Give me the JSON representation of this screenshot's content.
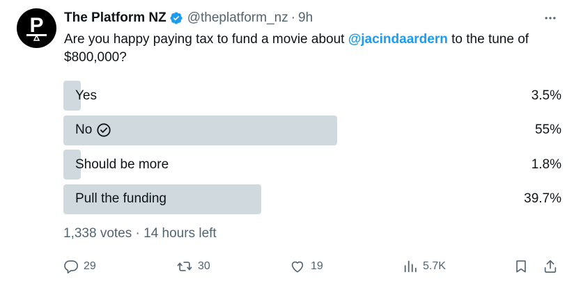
{
  "author": {
    "display_name": "The Platform NZ",
    "handle": "@theplatform_nz",
    "separator": "·",
    "time": "9h",
    "avatar_letter": "P"
  },
  "tweet": {
    "text_before": "Are you happy paying tax to fund a movie about ",
    "mention": "@jacindaardern",
    "text_after": " to the tune of $800,000?"
  },
  "poll": {
    "options": [
      {
        "label": "Yes",
        "percent_label": "3.5%",
        "percent": 3.5,
        "winner": false
      },
      {
        "label": "No",
        "percent_label": "55%",
        "percent": 55,
        "winner": true
      },
      {
        "label": "Should be more",
        "percent_label": "1.8%",
        "percent": 1.8,
        "winner": false
      },
      {
        "label": "Pull the funding",
        "percent_label": "39.7%",
        "percent": 39.7,
        "winner": false
      }
    ],
    "meta": "1,338 votes · 14 hours left"
  },
  "actions": {
    "replies": "29",
    "reposts": "30",
    "likes": "19",
    "views": "5.7K"
  },
  "colors": {
    "accent": "#1d9bf0",
    "poll_bar": "#cfd9de",
    "secondary_text": "#536471",
    "primary_text": "#0f1419"
  },
  "icons": {
    "verified": "verified-badge-icon",
    "more": "more-icon",
    "winner": "check-circle-icon",
    "reply": "reply-icon",
    "repost": "repost-icon",
    "like": "heart-icon",
    "views": "views-icon",
    "bookmark": "bookmark-icon",
    "share": "share-icon"
  }
}
